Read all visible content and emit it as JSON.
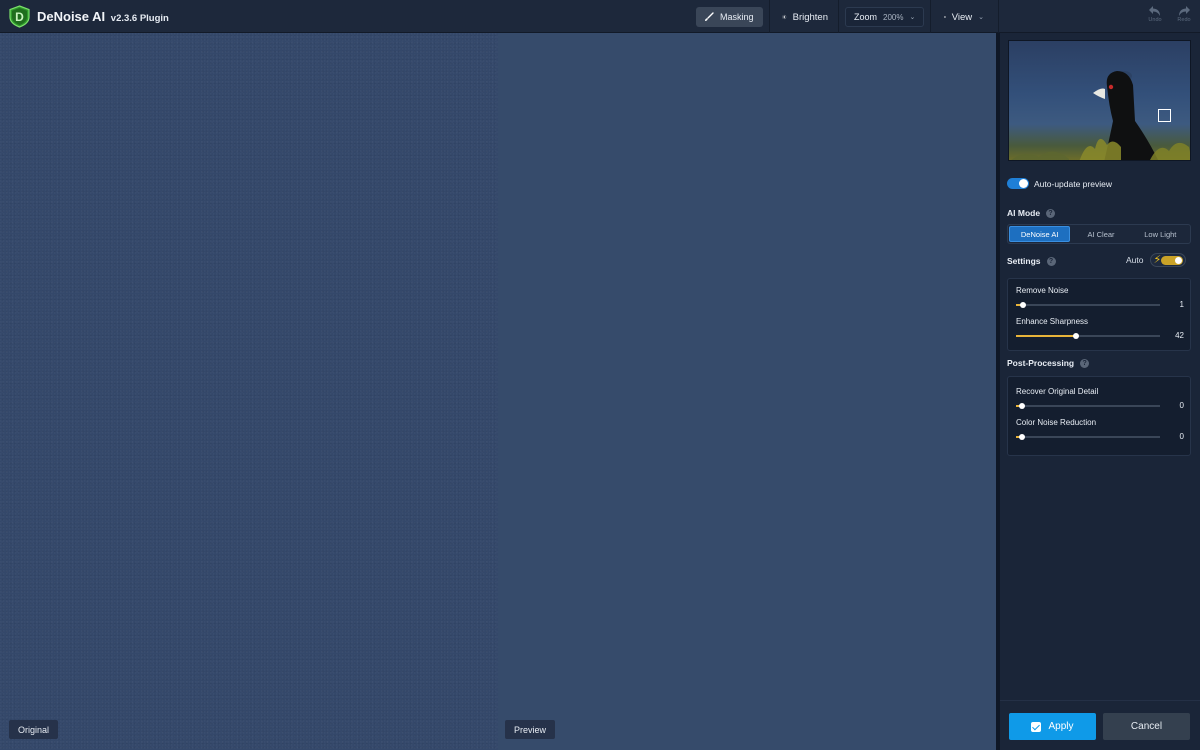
{
  "app": {
    "title": "DeNoise AI",
    "version": "v2.3.6 Plugin"
  },
  "toolbar": {
    "masking_label": "Masking",
    "brighten_label": "Brighten",
    "zoom_label": "Zoom",
    "zoom_value": "200%",
    "view_label": "View",
    "undo_label": "Undo",
    "redo_label": "Redo"
  },
  "canvas": {
    "original_label": "Original",
    "preview_label": "Preview"
  },
  "panel": {
    "auto_update_label": "Auto-update preview",
    "auto_update_on": true,
    "ai_mode": {
      "title": "AI Mode",
      "options": [
        "DeNoise AI",
        "AI Clear",
        "Low Light"
      ],
      "selected": "DeNoise AI"
    },
    "settings": {
      "title": "Settings",
      "auto_label": "Auto",
      "auto_on": true,
      "sliders": [
        {
          "label": "Remove Noise",
          "value": "1",
          "fraction": 0.05
        },
        {
          "label": "Enhance Sharpness",
          "value": "42",
          "fraction": 0.42
        }
      ]
    },
    "post_processing": {
      "title": "Post-Processing",
      "sliders": [
        {
          "label": "Recover Original Detail",
          "value": "0",
          "fraction": 0.0
        },
        {
          "label": "Color Noise Reduction",
          "value": "0",
          "fraction": 0.0
        }
      ]
    }
  },
  "actions": {
    "apply_label": "Apply",
    "cancel_label": "Cancel"
  },
  "colors": {
    "accent": "#0f9ae8",
    "slider_fill": "#e8b43a",
    "toggle_on": "#1f7fd6",
    "logo_green": "#3fc23a"
  }
}
